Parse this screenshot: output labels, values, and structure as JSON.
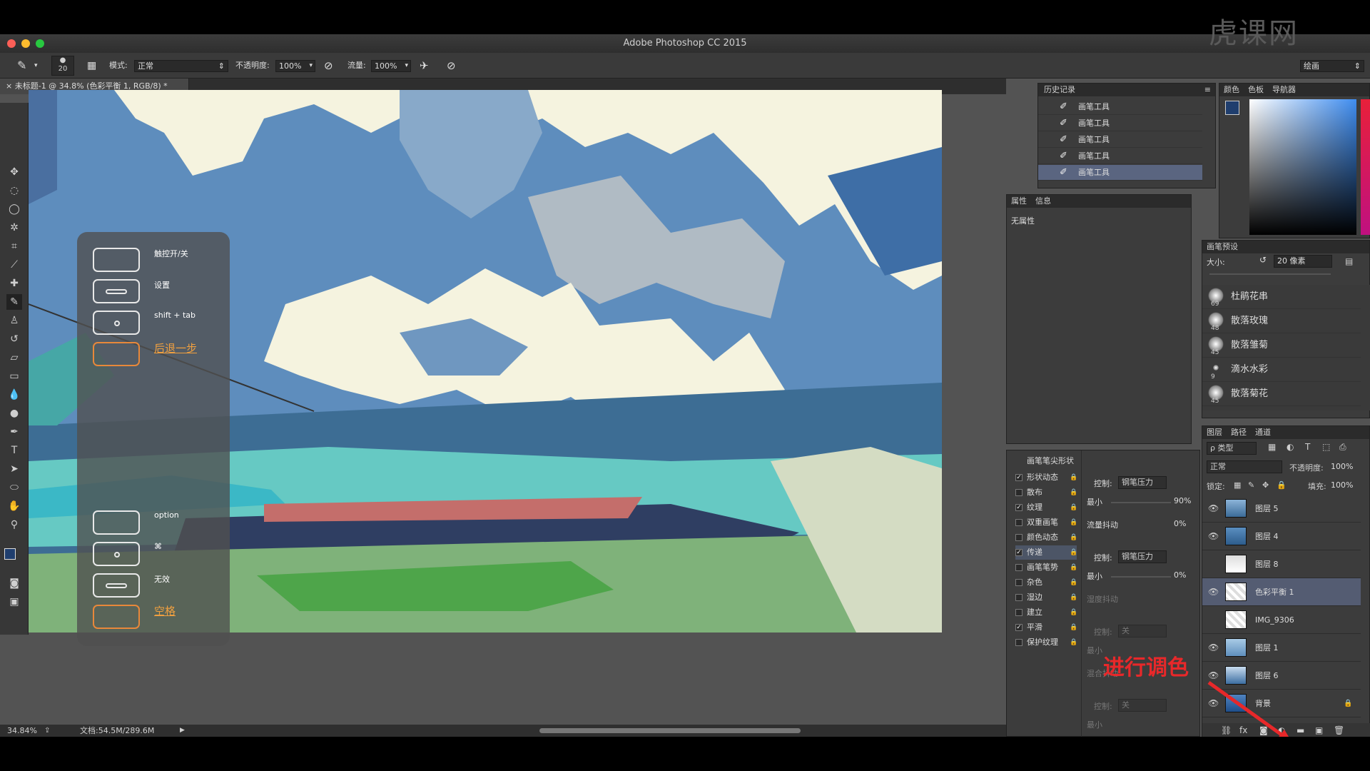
{
  "watermark": "虎课网",
  "window": {
    "title": "Adobe Photoshop CC 2015"
  },
  "options_bar": {
    "brush_size": "20",
    "mode_label": "模式:",
    "mode_value": "正常",
    "opacity_label": "不透明度:",
    "opacity_value": "100%",
    "flow_label": "流量:",
    "flow_value": "100%",
    "workspace_value": "绘画"
  },
  "document": {
    "tab_title": "未标题-1 @ 34.8% (色彩平衡 1, RGB/8) *"
  },
  "status": {
    "zoom": "34.84%",
    "doc_info": "文档:54.5M/289.6M"
  },
  "touch_overlay": {
    "items": [
      {
        "label": "触控开/关",
        "style": "white",
        "glyph": ""
      },
      {
        "label": "设置",
        "style": "white",
        "glyph": "bar"
      },
      {
        "label": "shift + tab",
        "style": "white",
        "glyph": "dot"
      },
      {
        "label": "后退一步",
        "style": "orange",
        "glyph": ""
      },
      {
        "label": "option",
        "style": "white",
        "glyph": ""
      },
      {
        "label": "⌘",
        "style": "white",
        "glyph": "dot"
      },
      {
        "label": "无效",
        "style": "white",
        "glyph": "bar"
      },
      {
        "label": "空格",
        "style": "orange",
        "glyph": ""
      }
    ]
  },
  "history_panel": {
    "tab": "历史记录",
    "items": [
      "画笔工具",
      "画笔工具",
      "画笔工具",
      "画笔工具",
      "画笔工具"
    ]
  },
  "color_panel": {
    "tabs": [
      "颜色",
      "色板",
      "导航器"
    ]
  },
  "properties_panel": {
    "tabs": [
      "属性",
      "信息"
    ],
    "content": "无属性"
  },
  "brush_presets_panel": {
    "tab": "画笔预设",
    "size_label": "大小:",
    "size_value": "20 像素",
    "brushes": [
      {
        "size": "69",
        "name": "杜鹃花串"
      },
      {
        "size": "48",
        "name": "散落玫瑰"
      },
      {
        "size": "45",
        "name": "散落雏菊"
      },
      {
        "size": "9",
        "name": "滴水水彩"
      },
      {
        "size": "45",
        "name": "散落菊花"
      }
    ]
  },
  "brush_panel": {
    "header": "画笔笔尖形状",
    "options": [
      {
        "label": "形状动态",
        "checked": true
      },
      {
        "label": "散布",
        "checked": false
      },
      {
        "label": "纹理",
        "checked": true
      },
      {
        "label": "双重画笔",
        "checked": false
      },
      {
        "label": "颜色动态",
        "checked": false
      },
      {
        "label": "传递",
        "checked": true
      },
      {
        "label": "画笔笔势",
        "checked": false
      },
      {
        "label": "杂色",
        "checked": false
      },
      {
        "label": "湿边",
        "checked": false
      },
      {
        "label": "建立",
        "checked": false
      },
      {
        "label": "平滑",
        "checked": true
      },
      {
        "label": "保护纹理",
        "checked": false
      }
    ],
    "control_label": "控制:",
    "control_value_1": "钢笔压力",
    "min_label": "最小",
    "min_value_1": "90%",
    "flow_jitter_label": "流量抖动",
    "flow_jitter_value": "0%",
    "control_value_2": "钢笔压力",
    "min_value_2": "0%",
    "wet_jitter_label": "湿度抖动",
    "control_value_3": "关",
    "mix_jitter_label": "混合抖动",
    "control_value_4": "关"
  },
  "layers_panel": {
    "tabs": [
      "图层",
      "路径",
      "通道"
    ],
    "filter_label": "ρ 类型",
    "blend_mode": "正常",
    "opacity_label": "不透明度:",
    "opacity_value": "100%",
    "lock_label": "锁定:",
    "fill_label": "填充:",
    "fill_value": "100%",
    "layers": [
      {
        "name": "图层 5",
        "visible": true,
        "selected": false
      },
      {
        "name": "图层 4",
        "visible": true,
        "selected": false
      },
      {
        "name": "图层 8",
        "visible": false,
        "selected": false
      },
      {
        "name": "色彩平衡 1",
        "visible": true,
        "selected": true
      },
      {
        "name": "IMG_9306",
        "visible": false,
        "selected": false
      },
      {
        "name": "图层 1",
        "visible": true,
        "selected": false
      },
      {
        "name": "图层 6",
        "visible": true,
        "selected": false
      },
      {
        "name": "背景",
        "visible": true,
        "selected": false
      }
    ]
  },
  "annotation": {
    "text": "进行调色",
    "color": "#e8282a"
  }
}
